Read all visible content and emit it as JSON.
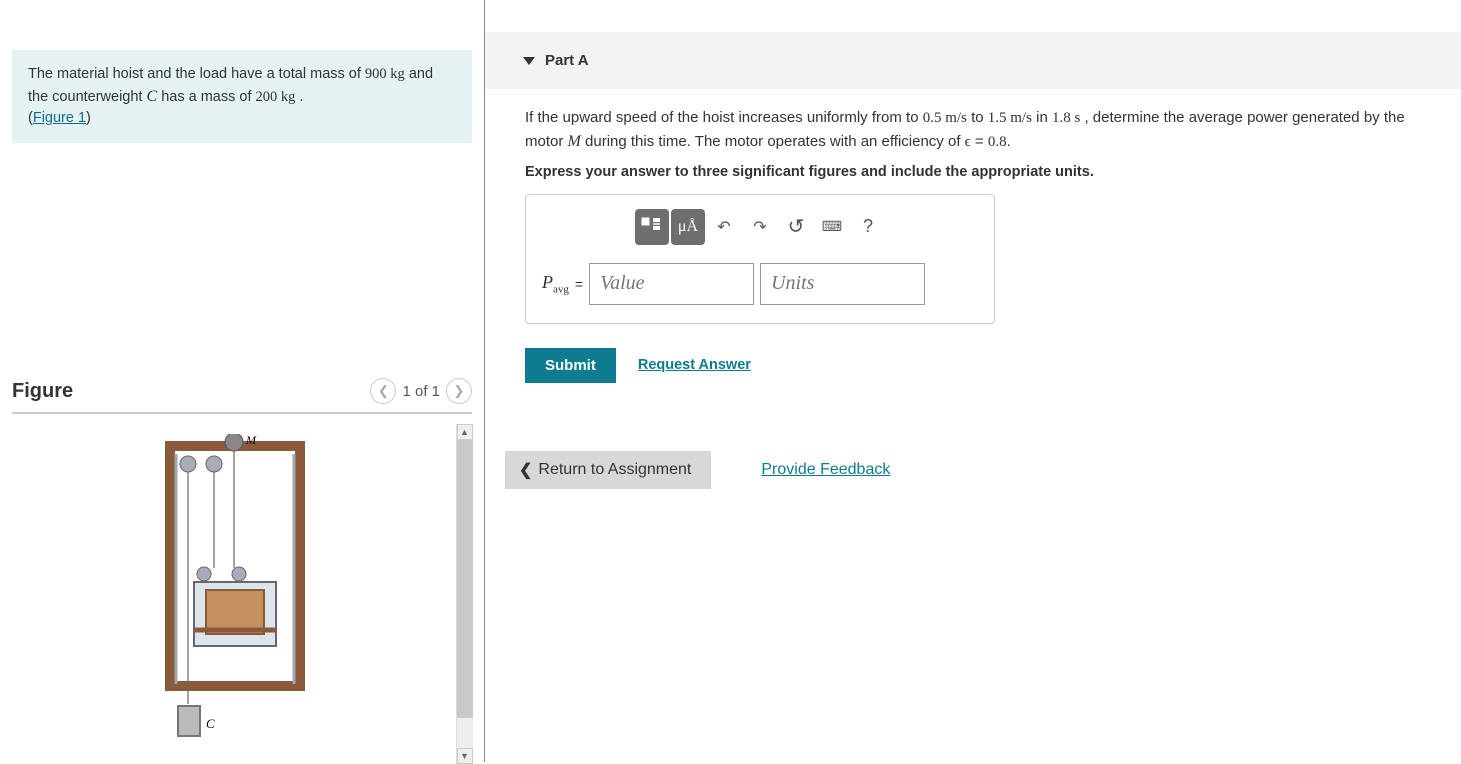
{
  "problem": {
    "line1_pre": "The material hoist and the load have a total mass of ",
    "mass1": "900 kg",
    "line1_mid": " and the counterweight ",
    "cvar": "C",
    "line1_post": " has a mass of ",
    "mass2": "200 kg",
    "period": ".",
    "figure_link": "Figure 1"
  },
  "figure": {
    "title": "Figure",
    "nav": "1 of 1",
    "labels": {
      "M": "M",
      "C": "C"
    }
  },
  "part": {
    "title": "Part A",
    "q_pre": "If the upward speed of the hoist increases uniformly from to ",
    "v1": "0.5 m/s",
    "q_to": " to ",
    "v2": "1.5 m/s",
    "q_in": " in ",
    "time": "1.8 s",
    "q_post": ", determine the average power generated by the motor ",
    "Mvar": "M",
    "q_during": " during this time. The motor operates with an efficiency of ",
    "eff_sym": "ϵ",
    "eff_eq": " = ",
    "eff_val": "0.8",
    "q_end": ".",
    "instruction": "Express your answer to three significant figures and include the appropriate units."
  },
  "toolbar": {
    "template": "template",
    "symbols": "μÅ",
    "undo": "↶",
    "redo": "↷",
    "reset": "↺",
    "keyboard": "⌨",
    "help": "?"
  },
  "answer": {
    "label_P": "P",
    "label_sub": "avg",
    "equals": " = ",
    "value_placeholder": "Value",
    "units_placeholder": "Units"
  },
  "actions": {
    "submit": "Submit",
    "request": "Request Answer"
  },
  "bottom": {
    "return": "Return to Assignment",
    "feedback": "Provide Feedback"
  }
}
